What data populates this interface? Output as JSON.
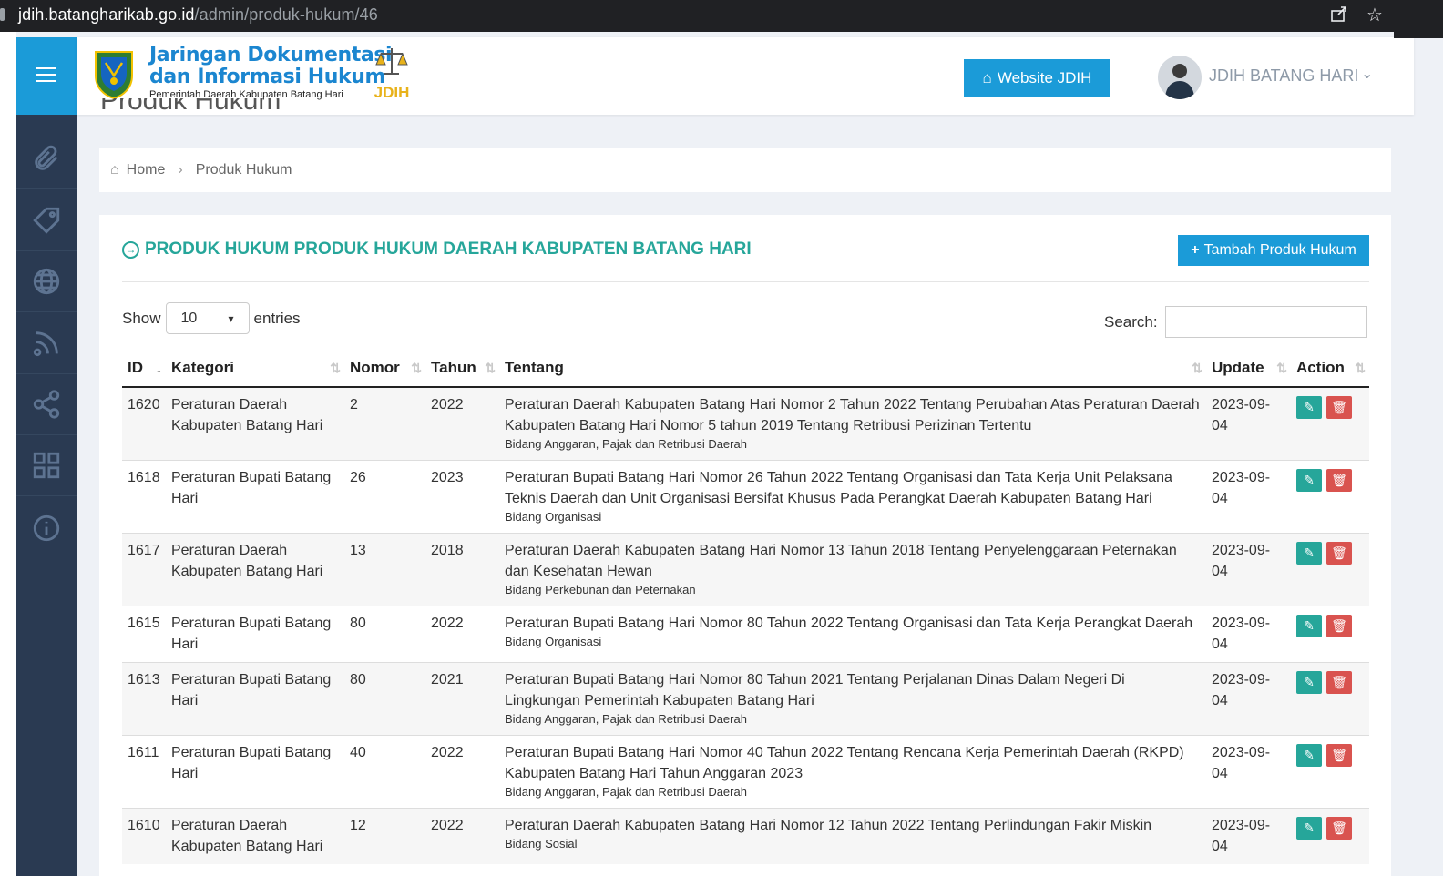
{
  "browser": {
    "url_host": "jdih.batangharikab.go.id",
    "url_path": "/admin/produk-hukum/46"
  },
  "header": {
    "logo_line1": "Jaringan Dokumentasi",
    "logo_line2": "dan Informasi Hukum",
    "logo_line3": "Pemerintah Daerah Kabupaten Batang Hari",
    "jdih_label": "JDIH",
    "website_button": "Website JDIH",
    "user_name": "JDIH BATANG HARI"
  },
  "page_title": "Produk Hukum",
  "breadcrumb": {
    "home": "Home",
    "current": "Produk Hukum"
  },
  "card": {
    "title": "PRODUK HUKUM PRODUK HUKUM DAERAH KABUPATEN BATANG HARI",
    "add_button": "Tambah Produk Hukum",
    "show_label": "Show",
    "show_value": "10",
    "entries_label": "entries",
    "search_label": "Search:"
  },
  "table": {
    "headers": [
      "ID",
      "Kategori",
      "Nomor",
      "Tahun",
      "Tentang",
      "Update",
      "Action"
    ],
    "rows": [
      {
        "id": "1620",
        "kategori": "Peraturan Daerah Kabupaten Batang Hari",
        "nomor": "2",
        "tahun": "2022",
        "tentang": "Peraturan Daerah Kabupaten Batang Hari Nomor 2 Tahun 2022 Tentang Perubahan Atas Peraturan Daerah Kabupaten Batang Hari Nomor 5 tahun 2019 Tentang Retribusi Perizinan Tertentu",
        "bidang": "Bidang Anggaran, Pajak dan Retribusi Daerah",
        "update": "2023-09-04"
      },
      {
        "id": "1618",
        "kategori": "Peraturan Bupati Batang Hari",
        "nomor": "26",
        "tahun": "2023",
        "tentang": "Peraturan Bupati Batang Hari Nomor 26 Tahun 2022 Tentang Organisasi dan Tata Kerja Unit Pelaksana Teknis Daerah dan Unit Organisasi Bersifat Khusus Pada Perangkat Daerah Kabupaten Batang Hari",
        "bidang": "Bidang Organisasi",
        "update": "2023-09-04"
      },
      {
        "id": "1617",
        "kategori": "Peraturan Daerah Kabupaten Batang Hari",
        "nomor": "13",
        "tahun": "2018",
        "tentang": "Peraturan Daerah Kabupaten Batang Hari Nomor 13 Tahun 2018 Tentang Penyelenggaraan Peternakan dan Kesehatan Hewan",
        "bidang": "Bidang Perkebunan dan Peternakan",
        "update": "2023-09-04"
      },
      {
        "id": "1615",
        "kategori": "Peraturan Bupati Batang Hari",
        "nomor": "80",
        "tahun": "2022",
        "tentang": "Peraturan Bupati Batang Hari Nomor 80 Tahun 2022 Tentang Organisasi dan Tata Kerja Perangkat Daerah",
        "bidang": "Bidang Organisasi",
        "update": "2023-09-04"
      },
      {
        "id": "1613",
        "kategori": "Peraturan Bupati Batang Hari",
        "nomor": "80",
        "tahun": "2021",
        "tentang": "Peraturan Bupati Batang Hari Nomor 80 Tahun 2021 Tentang Perjalanan Dinas Dalam Negeri Di Lingkungan Pemerintah Kabupaten Batang Hari",
        "bidang": "Bidang Anggaran, Pajak dan Retribusi Daerah",
        "update": "2023-09-04"
      },
      {
        "id": "1611",
        "kategori": "Peraturan Bupati Batang Hari",
        "nomor": "40",
        "tahun": "2022",
        "tentang": "Peraturan Bupati Batang Hari Nomor 40 Tahun 2022 Tentang Rencana Kerja Pemerintah Daerah (RKPD) Kabupaten Batang Hari Tahun Anggaran 2023",
        "bidang": "Bidang Anggaran, Pajak dan Retribusi Daerah",
        "update": "2023-09-04"
      },
      {
        "id": "1610",
        "kategori": "Peraturan Daerah Kabupaten Batang Hari",
        "nomor": "12",
        "tahun": "2022",
        "tentang": "Peraturan Daerah Kabupaten Batang Hari Nomor 12 Tahun 2022 Tentang Perlindungan Fakir Miskin",
        "bidang": "Bidang Sosial",
        "update": "2023-09-04"
      }
    ]
  },
  "colors": {
    "accent": "#1b9bd8",
    "title_teal": "#26a69a",
    "sidebar": "#2a3a52",
    "delete_red": "#d9534f"
  }
}
